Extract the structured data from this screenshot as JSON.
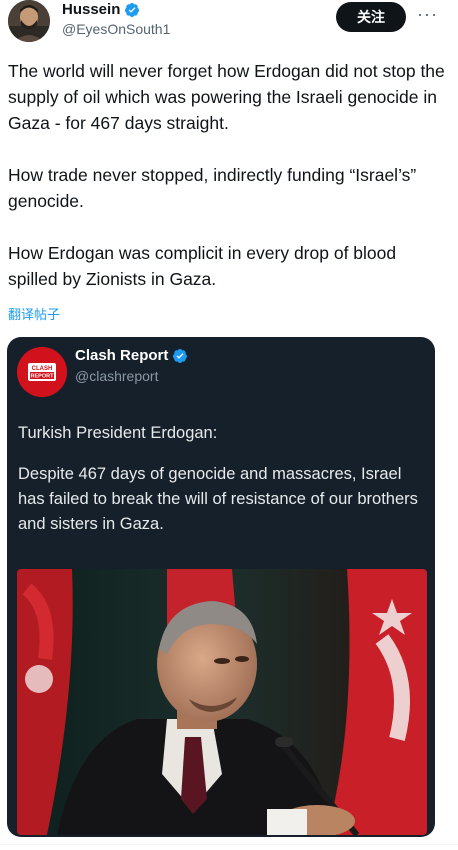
{
  "author": {
    "name": "Hussein",
    "handle": "@EyesOnSouth1",
    "verified": true
  },
  "follow_label": "关注",
  "more_label": "···",
  "tweet_paragraphs": [
    "The world will never forget how Erdogan did not stop the supply of oil which was powering the Israeli genocide in Gaza - for 467 days straight.",
    "How trade never stopped, indirectly funding “Israel’s” genocide.",
    "How Erdogan was complicit in every drop of blood spilled by Zionists in Gaza."
  ],
  "translate_label": "翻译帖子",
  "quoted": {
    "name": "Clash Report",
    "handle": "@clashreport",
    "verified": true,
    "logo_text": "CLASH REPORT",
    "paragraphs": [
      "Turkish President Erdogan:",
      "Despite 467 days of genocide and massacres, Israel has failed to break the will of resistance of our brothers and sisters in Gaza."
    ]
  },
  "colors": {
    "verified_blue": "#1d9bf0",
    "quote_bg": "#15202b",
    "flag_red": "#d5202a"
  }
}
